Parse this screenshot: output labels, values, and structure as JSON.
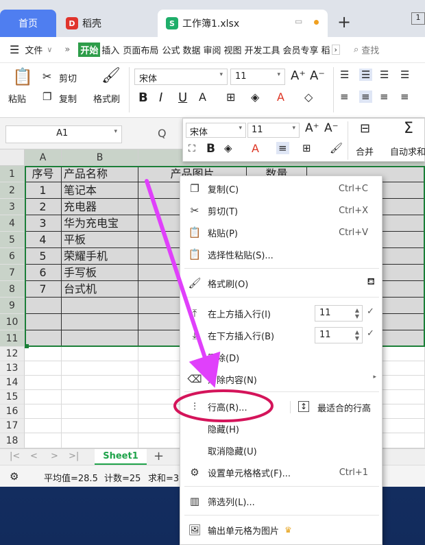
{
  "tabs": {
    "home": "首页",
    "daoke": "稻壳",
    "workbook": "工作簿1.xlsx",
    "new_tab": "+"
  },
  "menubar": {
    "file": "文件",
    "more": "»",
    "items": [
      "开始",
      "插入",
      "页面布局",
      "公式",
      "数据",
      "审阅",
      "视图",
      "开发工具",
      "会员专享",
      "稻"
    ],
    "search": "查找"
  },
  "ribbon": {
    "paste": "粘贴",
    "cut": "剪切",
    "copy": "复制",
    "format_painter": "格式刷",
    "font": "宋体",
    "size": "11",
    "bold": "B",
    "italic": "I",
    "underline": "U"
  },
  "formula": {
    "namebox": "A1",
    "fx": "Q"
  },
  "columns": [
    "A",
    "B"
  ],
  "rows": [
    "1",
    "2",
    "3",
    "4",
    "5",
    "6",
    "7",
    "8",
    "9",
    "10",
    "11",
    "12",
    "13",
    "14",
    "15",
    "16",
    "17",
    "18"
  ],
  "table": {
    "headers": [
      "序号",
      "产品名称",
      "产品图片",
      "数量"
    ],
    "data": [
      [
        "1",
        "笔记本"
      ],
      [
        "2",
        "充电器"
      ],
      [
        "3",
        "华为充电宝"
      ],
      [
        "4",
        "平板"
      ],
      [
        "5",
        "荣耀手机"
      ],
      [
        "6",
        "手写板"
      ],
      [
        "7",
        "台式机"
      ]
    ]
  },
  "minibar": {
    "font": "宋体",
    "size": "11",
    "bold": "B",
    "merge": "合并",
    "autosum": "自动求和"
  },
  "context_menu": {
    "copy": {
      "label": "复制(C)",
      "shortcut": "Ctrl+C"
    },
    "cut": {
      "label": "剪切(T)",
      "shortcut": "Ctrl+X"
    },
    "paste": {
      "label": "粘贴(P)",
      "shortcut": "Ctrl+V"
    },
    "paste_special": "选择性粘贴(S)...",
    "format_painter": "格式刷(O)",
    "insert_above": {
      "label": "在上方插入行(I)",
      "value": "11"
    },
    "insert_below": {
      "label": "在下方插入行(B)",
      "value": "11"
    },
    "delete": "删除(D)",
    "clear": "清除内容(N)",
    "row_height": "行高(R)...",
    "best_fit": "最适合的行高",
    "hide": "隐藏(H)",
    "unhide": "取消隐藏(U)",
    "format_cells": {
      "label": "设置单元格格式(F)...",
      "shortcut": "Ctrl+1"
    },
    "filter": "筛选列(L)...",
    "export_image": "输出单元格为图片"
  },
  "sheet": {
    "name": "Sheet1",
    "add": "+"
  },
  "status": {
    "average": "平均值=28.5",
    "count": "计数=25",
    "sum": "求和=3"
  },
  "colors": {
    "accent": "#4f7ef0",
    "selection_border": "#1a7f37",
    "annotation": "#d4145a",
    "arrow": "#e040fb"
  }
}
